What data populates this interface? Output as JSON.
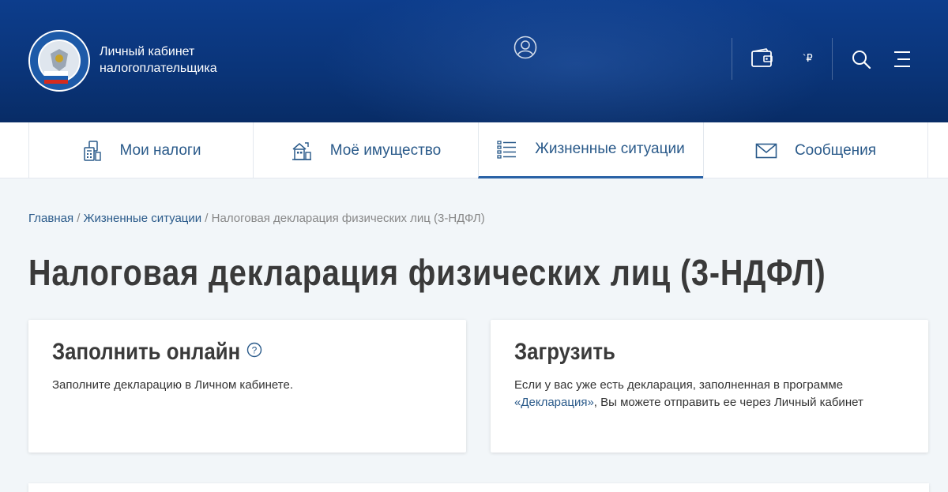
{
  "header": {
    "brand_line1": "Личный кабинет",
    "brand_line2": "налогоплательщика",
    "balance": "`₽"
  },
  "nav": {
    "items": [
      {
        "label": "Мои налоги",
        "icon": "calculator-icon"
      },
      {
        "label": "Моё имущество",
        "icon": "property-icon"
      },
      {
        "label": "Жизненные ситуации",
        "icon": "list-icon",
        "active": true
      },
      {
        "label": "Сообщения",
        "icon": "envelope-icon"
      }
    ]
  },
  "breadcrumb": {
    "home": "Главная",
    "sep": " / ",
    "section": "Жизненные ситуации",
    "current": "Налоговая декларация физических лиц (3-НДФЛ)"
  },
  "page": {
    "title": "Налоговая декларация физических лиц (3-НДФЛ)"
  },
  "cards": {
    "fill_online": {
      "title": "Заполнить онлайн",
      "text": "Заполните декларацию в Личном кабинете."
    },
    "upload": {
      "title": "Загрузить",
      "text_before": "Если у вас уже есть декларация, заполненная в программе ",
      "link": "«Декларация»",
      "text_after": ", Вы можете отправить ее через Личный кабинет"
    }
  },
  "colors": {
    "header_bg": "#0d3d8c",
    "accent": "#2a5a8a",
    "page_bg": "#f2f6f9"
  }
}
